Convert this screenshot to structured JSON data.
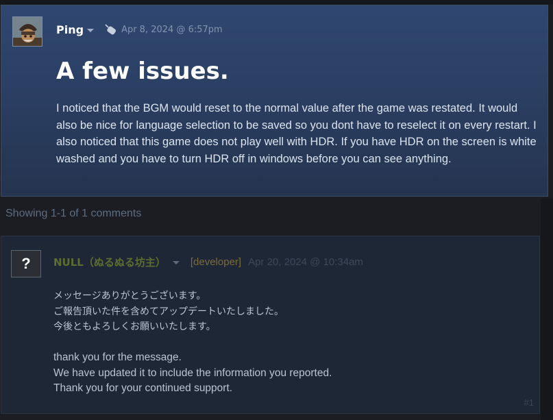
{
  "post": {
    "author": "Ping",
    "date": "Apr 8, 2024 @ 6:57pm",
    "title": "A few issues.",
    "body": "I noticed that the BGM would reset to the normal value after the game was restated. It would also be nice for language selection to be saved so you dont have to reselect it on every restart. I also noticed that this game does not play well with HDR. If you have HDR on the screen is white washed and you have to turn HDR off in windows before you can see anything.",
    "icons": {
      "avatar": "avatar",
      "menu": "chevron-down-icon",
      "review_type": "mouse-icon"
    }
  },
  "comments_summary": "Showing 1-1 of 1 comments",
  "comment": {
    "avatar_glyph": "?",
    "author": "NULL（ぬるぬる坊主）",
    "role": "[developer]",
    "date": "Apr 20, 2024 @ 10:34am",
    "lines": [
      "メッセージありがとうございます。",
      "ご報告頂いた件を含めてアップデートいたしました。",
      "今後ともよろしくお願いいたします。",
      "",
      "thank you for the message.",
      "We have updated it to include the information you reported.",
      "Thank you for your continued support."
    ],
    "index": "#1"
  },
  "colors": {
    "post_background": "#2f4770",
    "comment_background": "#1e2735",
    "developer_name": "#5c6e30",
    "developer_tag": "#7c6a3a"
  }
}
